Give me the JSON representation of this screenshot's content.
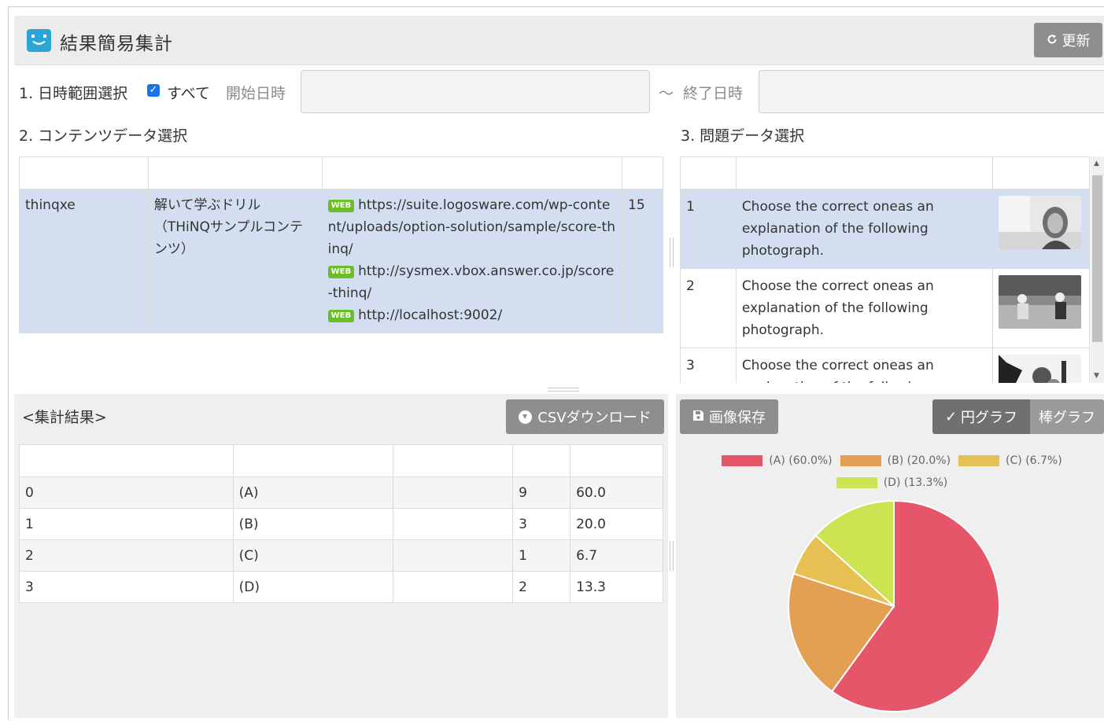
{
  "header": {
    "title": "結果簡易集計",
    "refresh_label": "更新"
  },
  "filters": {
    "date_range_label": "1. 日時範囲選択",
    "all_checked": true,
    "all_label": "すべて",
    "start_label": "開始日時",
    "start_value": "",
    "separator": "～",
    "end_label": "終了日時",
    "end_value": ""
  },
  "contents": {
    "section_label": "2. コンテンツデータ選択",
    "rows": [
      {
        "id": "thinqxe",
        "name": "解いて学ぶドリル（THiNQサンプルコンテンツ）",
        "links": [
          {
            "badge": "WEB",
            "url": "https://suite.logosware.com/wp-content/uploads/option-solution/sample/score-thinq/"
          },
          {
            "badge": "WEB",
            "url": "http://sysmex.vbox.answer.co.jp/score-thinq/"
          },
          {
            "badge": "WEB",
            "url": "http://localhost:9002/"
          }
        ],
        "count": "15"
      }
    ]
  },
  "questions": {
    "section_label": "3. 問題データ選択",
    "rows": [
      {
        "no": "1",
        "text": "Choose the correct oneas an explanation of the following photograph.",
        "image": "woman-portrait-photo"
      },
      {
        "no": "2",
        "text": "Choose the correct oneas an explanation of the following photograph.",
        "image": "people-outdoors-photo"
      },
      {
        "no": "3",
        "text": "Choose the correct oneas an explanation of the following photograph.",
        "image": "graphic-pattern-photo"
      }
    ]
  },
  "results": {
    "title": "<集計結果>",
    "csv_label": "CSVダウンロード",
    "rows": [
      {
        "index": "0",
        "choice": "(A)",
        "extra": "",
        "count": "9",
        "percent": "60.0"
      },
      {
        "index": "1",
        "choice": "(B)",
        "extra": "",
        "count": "3",
        "percent": "20.0"
      },
      {
        "index": "2",
        "choice": "(C)",
        "extra": "",
        "count": "1",
        "percent": "6.7"
      },
      {
        "index": "3",
        "choice": "(D)",
        "extra": "",
        "count": "2",
        "percent": "13.3"
      }
    ]
  },
  "chart_panel": {
    "save_label": "画像保存",
    "pie_label": "円グラフ",
    "bar_label": "棒グラフ",
    "active": "pie"
  },
  "chart_data": {
    "type": "pie",
    "categories": [
      "(A)",
      "(B)",
      "(C)",
      "(D)"
    ],
    "values": [
      60.0,
      20.0,
      6.7,
      13.3
    ],
    "legend_labels": [
      "(A)  (60.0%)",
      "(B)  (20.0%)",
      "(C)  (6.7%)",
      "(D)  (13.3%)"
    ],
    "colors": [
      "#e5566a",
      "#e39f52",
      "#e6c052",
      "#cde351"
    ],
    "legend_position": "top"
  }
}
